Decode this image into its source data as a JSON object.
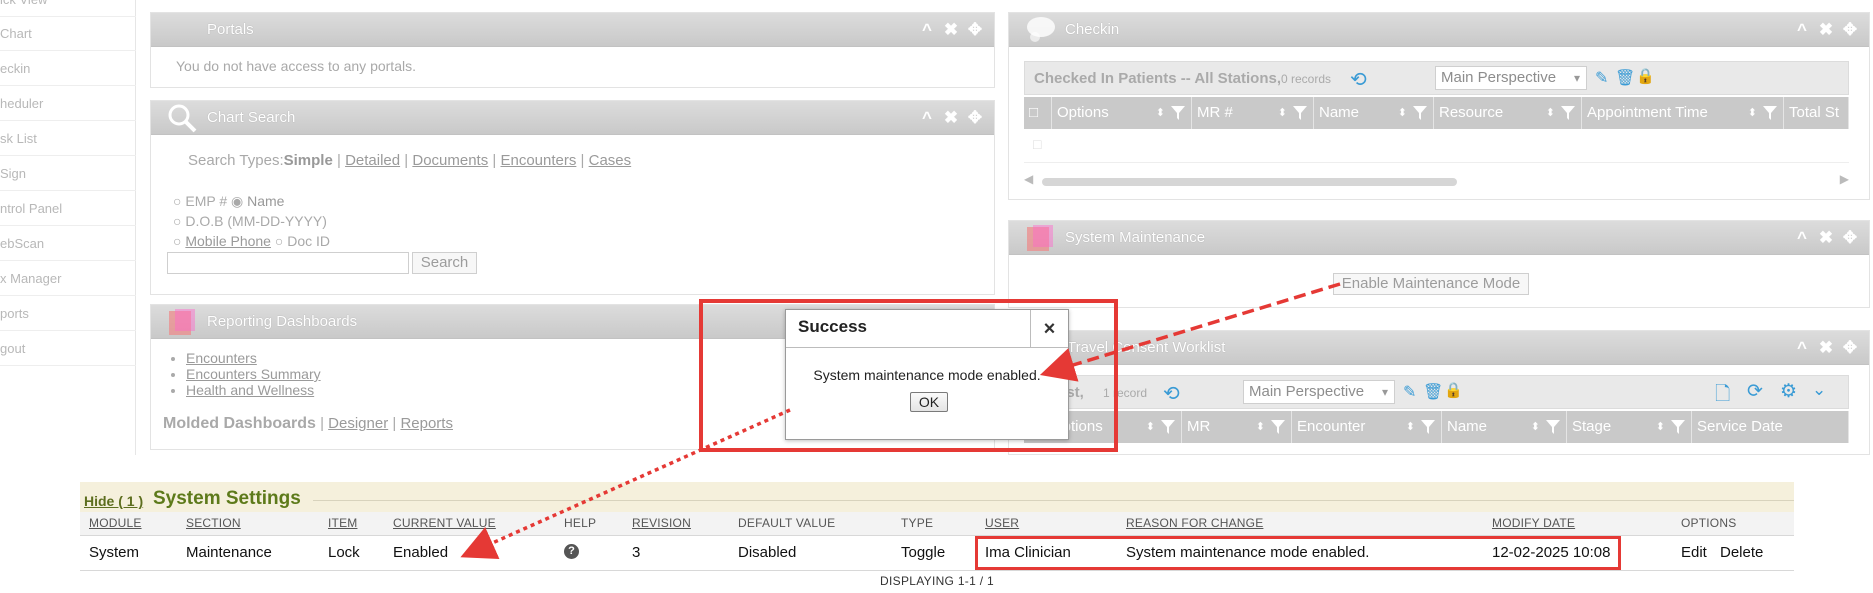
{
  "sidebar": {
    "items": [
      "ick View",
      "Chart",
      "eckin",
      "heduler",
      "sk List",
      "Sign",
      "ntrol Panel",
      "ebScan",
      "x Manager",
      "ports",
      "gout"
    ]
  },
  "portals": {
    "title": "Portals",
    "message": "You do not have access to any portals."
  },
  "chart_search": {
    "title": "Chart Search",
    "search_types_label": "Search Types:",
    "simple": "Simple",
    "types": [
      "Detailed",
      "Documents",
      "Encounters",
      "Cases"
    ],
    "radio_emp": "EMP #",
    "radio_name": "Name",
    "radio_dob": "D.O.B (MM-DD-YYYY)",
    "radio_mobile": "Mobile Phone",
    "radio_docid": "Doc ID",
    "search_button": "Search"
  },
  "reporting": {
    "title": "Reporting Dashboards",
    "links": [
      "Encounters",
      "Encounters Summary",
      "Health and Wellness"
    ],
    "molded_label": "Molded Dashboards",
    "designer": "Designer",
    "reports": "Reports"
  },
  "checkin": {
    "title": "Checkin",
    "grid_title": "Checked In Patients -- All Stations,",
    "records": "0 records",
    "perspective": "Main Perspective",
    "columns": [
      "Options",
      "MR #",
      "Name",
      "Resource",
      "Appointment Time",
      "Total St"
    ]
  },
  "system_maintenance": {
    "title": "System Maintenance",
    "button": "Enable Maintenance Mode"
  },
  "travel": {
    "title": "Travel Consent Worklist",
    "grid_title": "list,",
    "records": "1 record",
    "perspective": "Main Perspective",
    "columns": [
      "Options",
      "MR",
      "Encounter",
      "Name",
      "Stage",
      "Service Date"
    ]
  },
  "dialog": {
    "title": "Success",
    "close": "×",
    "message": "System maintenance mode enabled.",
    "ok": "OK"
  },
  "settings": {
    "hide_link": "Hide ( 1 )",
    "title": "System Settings",
    "columns": [
      "MODULE",
      "SECTION",
      "ITEM",
      "CURRENT VALUE",
      "HELP",
      "REVISION",
      "DEFAULT VALUE",
      "TYPE",
      "USER",
      "REASON FOR CHANGE",
      "MODIFY DATE",
      "OPTIONS"
    ],
    "row": {
      "module": "System",
      "section": "Maintenance",
      "item": "Lock",
      "current_value": "Enabled",
      "help": "?",
      "revision": "3",
      "default_value": "Disabled",
      "type": "Toggle",
      "user": "Ima Clinician",
      "reason": "System maintenance mode enabled.",
      "modify_date": "12-02-2025 10:08",
      "edit": "Edit",
      "delete": "Delete"
    },
    "displaying": "DISPLAYING 1-1 / 1"
  },
  "colors": {
    "annotation_red": "#e53935",
    "panel_header": "#c9c9c9",
    "settings_title": "#5d7a1a"
  }
}
